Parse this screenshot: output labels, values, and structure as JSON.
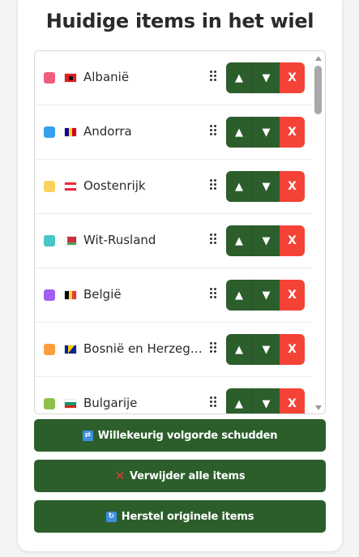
{
  "title": "Huidige items in het wiel",
  "items": [
    {
      "label": "Albanië",
      "color": "#f25c7e",
      "flag": "albania",
      "up": "▲",
      "down": "▼",
      "delete": "X"
    },
    {
      "label": "Andorra",
      "color": "#35a1ee",
      "flag": "andorra",
      "up": "▲",
      "down": "▼",
      "delete": "X"
    },
    {
      "label": "Oostenrijk",
      "color": "#fcd35a",
      "flag": "austria",
      "up": "▲",
      "down": "▼",
      "delete": "X"
    },
    {
      "label": "Wit-Rusland",
      "color": "#48c6c8",
      "flag": "belarus",
      "up": "▲",
      "down": "▼",
      "delete": "X"
    },
    {
      "label": "België",
      "color": "#a25ef2",
      "flag": "belgium",
      "up": "▲",
      "down": "▼",
      "delete": "X"
    },
    {
      "label": "Bosnië en Herzegovina",
      "color": "#fb9d3c",
      "flag": "bosnia",
      "up": "▲",
      "down": "▼",
      "delete": "X"
    },
    {
      "label": "Bulgarije",
      "color": "#8ec14b",
      "flag": "bulgaria",
      "up": "▲",
      "down": "▼",
      "delete": "X"
    }
  ],
  "actions": {
    "shuffle": {
      "icon": "shuffle-icon",
      "label": "Willekeurig volgorde schudden"
    },
    "remove_all": {
      "icon": "cross-icon",
      "label": "Verwijder alle items"
    },
    "restore": {
      "icon": "restore-icon",
      "label": "Herstel originele items"
    }
  },
  "colors": {
    "button_green": "#2c5e2c",
    "delete_red": "#f44336"
  }
}
